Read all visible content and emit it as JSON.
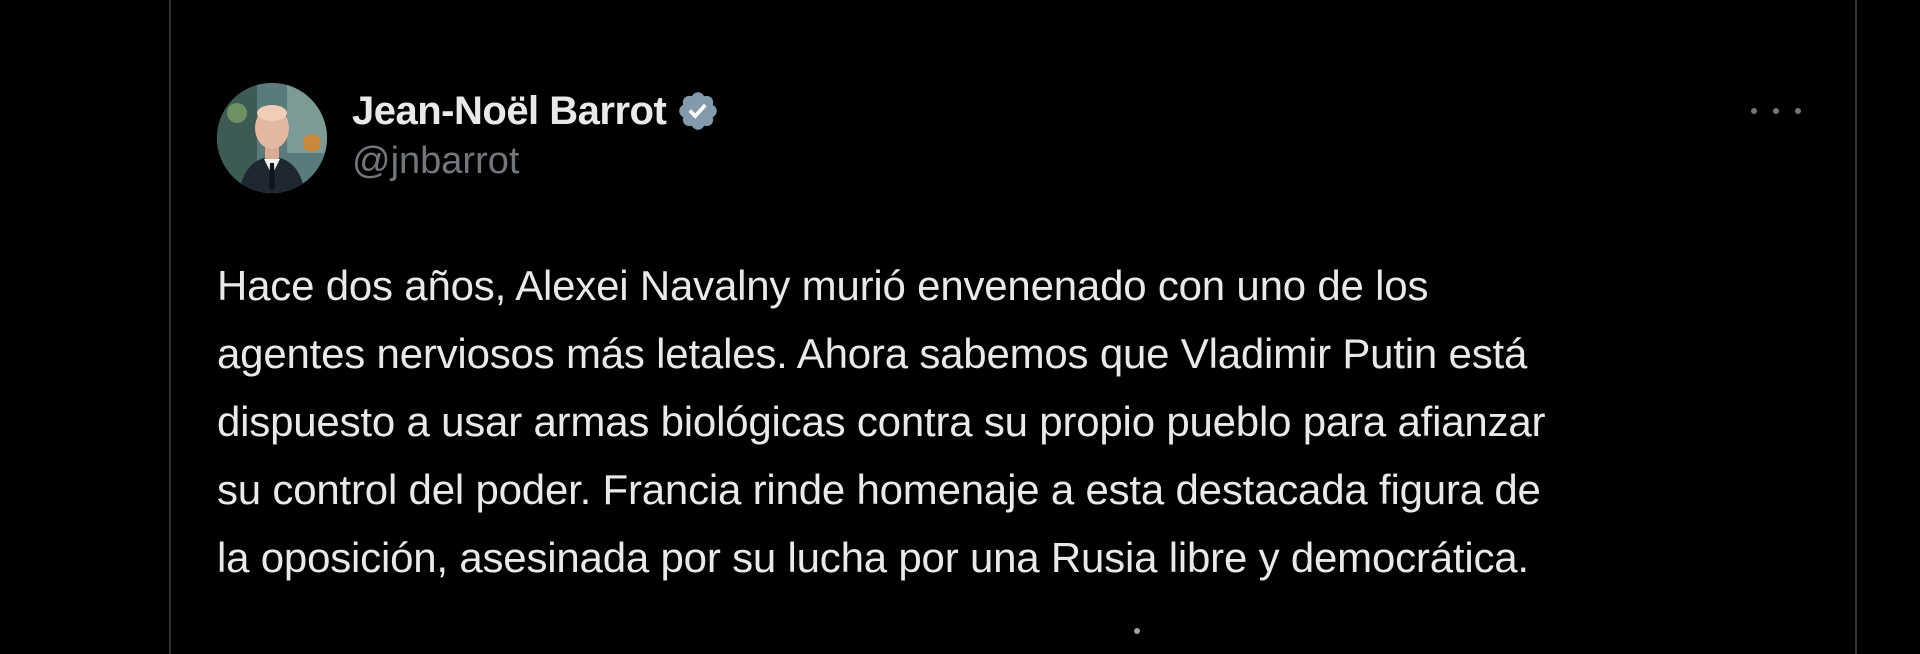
{
  "tweet": {
    "author": {
      "display_name": "Jean-Noël Barrot",
      "handle": "@jnbarrot",
      "verified": true,
      "verified_icon": "verified-badge-icon",
      "verified_color": "#829aab"
    },
    "more_icon": "more-options-icon",
    "text": "Hace dos años, Alexei Navalny murió envenenado con uno de los\nagentes nerviosos más letales. Ahora sabemos que Vladimir Putin está\ndispuesto a usar armas biológicas contra su propio pueblo para afianzar\nsu control del poder. Francia rinde homenaje a esta destacada figura de\nla oposición, asesinada por su lucha por una Rusia libre y democrática."
  },
  "colors": {
    "background": "#000000",
    "text_primary": "#e7e9ea",
    "text_secondary": "#71767b",
    "border": "#2f3336"
  }
}
